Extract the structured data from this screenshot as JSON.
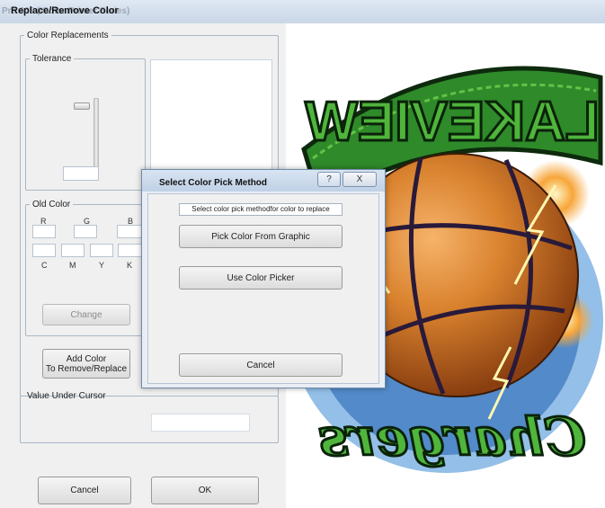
{
  "titlebar": {
    "background_title": "Pro 605 (IColor Printer Series)",
    "title": "Replace/Remove Color"
  },
  "color_replacements": {
    "legend": "Color Replacements",
    "tolerance": {
      "legend": "Tolerance"
    }
  },
  "old_color": {
    "legend": "Old Color",
    "rgb_labels": [
      "R",
      "G",
      "B"
    ],
    "cmyk_labels": [
      "C",
      "M",
      "Y",
      "K"
    ],
    "change_label": "Change"
  },
  "add_color_button": {
    "line1": "Add Color",
    "line2": "To Remove/Replace"
  },
  "value_under_cursor": {
    "legend": "Value Under Cursor"
  },
  "footer": {
    "cancel_label": "Cancel",
    "ok_label": "OK"
  },
  "modal": {
    "title": "Select Color Pick Method",
    "instruction": "Select color pick methodfor color to replace",
    "pick_from_graphic_label": "Pick Color From Graphic",
    "use_picker_label": "Use Color Picker",
    "cancel_label": "Cancel",
    "help_symbol": "?",
    "close_symbol": "X"
  },
  "artwork": {
    "top_text": "LAKEVIEW",
    "script_text": "Chargers"
  }
}
